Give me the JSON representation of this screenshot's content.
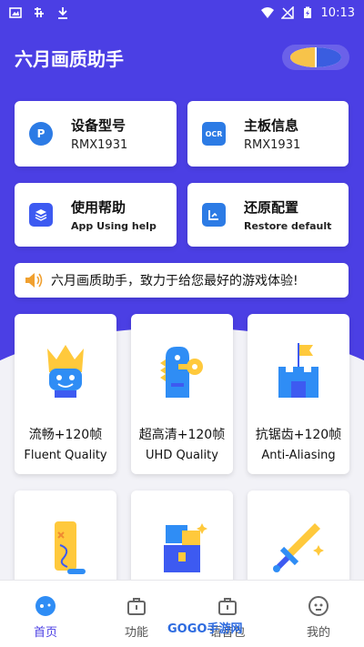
{
  "status": {
    "time": "10:13",
    "left_icons": [
      "image-icon",
      "carrier-icon",
      "download-icon"
    ],
    "right_icons": [
      "wifi-icon",
      "no-sim-icon",
      "battery-charging-icon"
    ]
  },
  "app": {
    "title": "六月画质助手",
    "accent": "#4b3fe4"
  },
  "info_cards": [
    {
      "title": "设备型号",
      "sub": "RMX1931",
      "icon": "pen-p-icon",
      "icon_color": "#2c7be5"
    },
    {
      "title": "主板信息",
      "sub": "RMX1931",
      "icon": "ocr-icon",
      "icon_color": "#2c7be5"
    },
    {
      "title": "使用帮助",
      "sub": "App Using help",
      "icon": "layers-icon",
      "icon_color": "#3d5af1"
    },
    {
      "title": "还原配置",
      "sub": "Restore default",
      "icon": "restore-icon",
      "icon_color": "#2c7be5"
    }
  ],
  "notice": {
    "text": "六月画质助手，致力于给您最好的游戏体验!"
  },
  "features": [
    {
      "cn": "流畅+120帧",
      "en": "Fluent Quality",
      "icon": "crown-face-icon"
    },
    {
      "cn": "超高清+120帧",
      "en": "UHD Quality",
      "icon": "dino-key-icon"
    },
    {
      "cn": "抗锯齿+120帧",
      "en": "Anti-Aliasing",
      "icon": "castle-flag-icon"
    },
    {
      "cn": "",
      "en": "",
      "icon": "scroll-map-icon"
    },
    {
      "cn": "",
      "en": "",
      "icon": "treasure-chest-icon"
    },
    {
      "cn": "",
      "en": "",
      "icon": "sword-icon"
    }
  ],
  "nav": [
    {
      "label": "首页",
      "icon": "gamepad-icon",
      "active": true
    },
    {
      "label": "功能",
      "icon": "toolbox-icon",
      "active": false
    },
    {
      "label": "语音包",
      "icon": "toolbox-icon",
      "active": false
    },
    {
      "label": "我的",
      "icon": "robot-face-icon",
      "active": false
    }
  ],
  "watermark": "GOGO手游网"
}
